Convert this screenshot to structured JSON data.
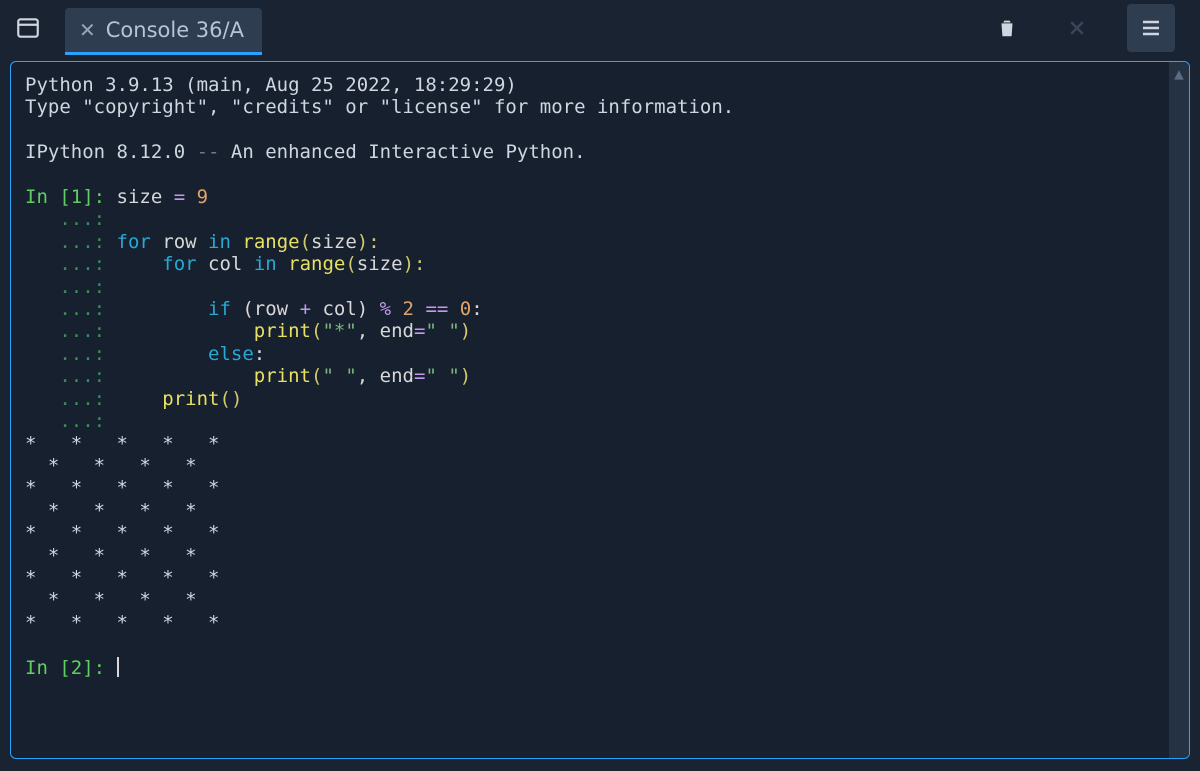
{
  "colors": {
    "bg": "#1a2332",
    "panel": "#17202e",
    "accent": "#2aa3ff",
    "tab_bg": "#2e3d50"
  },
  "tab": {
    "label": "Console 36/A",
    "close_glyph": "✕"
  },
  "toolbar": {
    "trash_title": "Clear console",
    "close_title": "Close",
    "menu_title": "Menu"
  },
  "header": {
    "line1": "Python 3.9.13 (main, Aug 25 2022, 18:29:29)",
    "line2": "Type \"copyright\", \"credits\" or \"license\" for more information.",
    "line3_a": "IPython 8.12.0 ",
    "line3_sep": "--",
    "line3_b": " An enhanced Interactive Python."
  },
  "prompts": {
    "in1": "In [1]: ",
    "cont": "   ...: ",
    "in2": "In [2]: "
  },
  "code": {
    "l1": {
      "a": "size ",
      "eq": "= ",
      "n": "9"
    },
    "l3": {
      "kw1": "for ",
      "id1": "row ",
      "kw2": "in ",
      "fn": "range",
      "lp": "(",
      "arg": "size",
      "rp": "):"
    },
    "l4": {
      "pad": "    ",
      "kw1": "for ",
      "id1": "col ",
      "kw2": "in ",
      "fn": "range",
      "lp": "(",
      "arg": "size",
      "rp": "):"
    },
    "l6": {
      "pad": "        ",
      "kw": "if ",
      "expr_a": "(row ",
      "op1": "+",
      "expr_b": " col) ",
      "op2": "% ",
      "n1": "2 ",
      "op3": "== ",
      "n2": "0",
      "colon": ":"
    },
    "l7": {
      "pad": "            ",
      "fn": "print",
      "lp": "(",
      "s1": "\"*\"",
      "comma": ", ",
      "kw": "end",
      "eq": "=",
      "s2": "\" \"",
      "rp": ")"
    },
    "l8": {
      "pad": "        ",
      "kw": "else",
      "colon": ":"
    },
    "l9": {
      "pad": "            ",
      "fn": "print",
      "lp": "(",
      "s1": "\" \"",
      "comma": ", ",
      "kw": "end",
      "eq": "=",
      "s2": "\" \"",
      "rp": ")"
    },
    "l10": {
      "pad": "    ",
      "fn": "print",
      "lp": "(",
      "rp": ")"
    }
  },
  "output": {
    "rows": [
      "*   *   *   *   *",
      "  *   *   *   *  ",
      "*   *   *   *   *",
      "  *   *   *   *  ",
      "*   *   *   *   *",
      "  *   *   *   *  ",
      "*   *   *   *   *",
      "  *   *   *   *  ",
      "*   *   *   *   *"
    ]
  }
}
